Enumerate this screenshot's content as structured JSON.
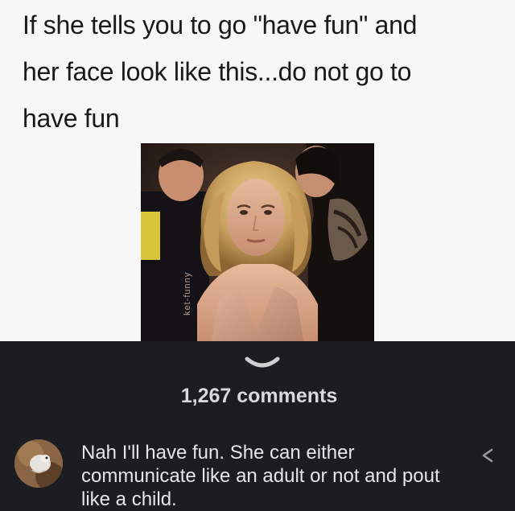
{
  "meme": {
    "caption": "If she tells you to go \"have fun\" and\nher face look like this...do not go to\nhave fun",
    "watermark": "ket-funny"
  },
  "thread": {
    "collapse_icon": "chevron-down-icon",
    "comment_count": "1,267 comments"
  },
  "comment": {
    "avatar_icon": "user-avatar",
    "text": "Nah I'll have fun. She can either communicate like an adult or not and pout like a child.",
    "action_icon": "share-icon"
  },
  "colors": {
    "meme_background": "#f7f7f7",
    "dark_background": "#1c1d21",
    "text_light": "#e6e6e6",
    "text_dark": "#1a1a1a"
  }
}
